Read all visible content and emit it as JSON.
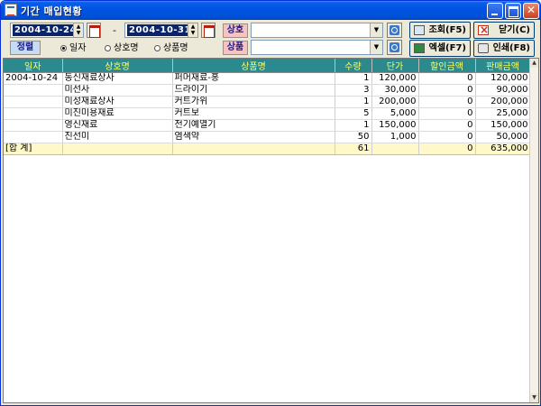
{
  "window": {
    "title": "기간 매입현황"
  },
  "filters": {
    "date_from": "2004-10-24",
    "date_sep": "-",
    "date_to": "2004-10-31",
    "vendor_label": "상호",
    "vendor_value": "",
    "product_label": "상품",
    "product_value": "",
    "sort_label": "정렬",
    "sort_options": [
      "일자",
      "상호명",
      "상품명"
    ],
    "sort_selected": "일자"
  },
  "actions": {
    "search": "조회(F5)",
    "close": "닫기(C)",
    "excel": "엑셀(F7)",
    "print": "인쇄(F8)"
  },
  "table": {
    "columns": [
      "일자",
      "상호명",
      "상품명",
      "수량",
      "단가",
      "할인금액",
      "판매금액"
    ],
    "rows": [
      [
        "2004-10-24",
        "동신재료상사",
        "퍼머재료-홍",
        "1",
        "120,000",
        "0",
        "120,000"
      ],
      [
        "",
        "미선사",
        "드라이기",
        "3",
        "30,000",
        "0",
        "90,000"
      ],
      [
        "",
        "미성재료상사",
        "커트가위",
        "1",
        "200,000",
        "0",
        "200,000"
      ],
      [
        "",
        "미진미용재료",
        "커트보",
        "5",
        "5,000",
        "0",
        "25,000"
      ],
      [
        "",
        "영신재료",
        "전기예열기",
        "1",
        "150,000",
        "0",
        "150,000"
      ],
      [
        "",
        "진선미",
        "염색약",
        "50",
        "1,000",
        "0",
        "50,000"
      ]
    ],
    "total": [
      "[합 계]",
      "",
      "",
      "61",
      "",
      "0",
      "635,000"
    ]
  }
}
